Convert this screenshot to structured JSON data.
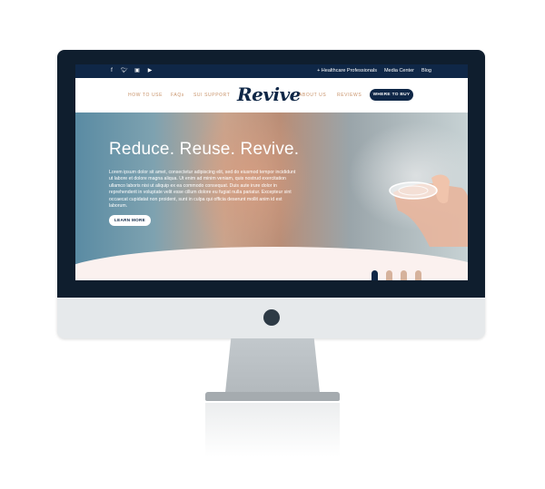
{
  "topbar": {
    "social": [
      "facebook-icon",
      "twitter-icon",
      "instagram-icon",
      "youtube-icon"
    ],
    "links": {
      "healthcare": "+ Healthcare Professionals",
      "media": "Media Center",
      "blog": "Blog"
    }
  },
  "nav": {
    "how_to_use": "HOW TO USE",
    "faqs": "FAQs",
    "sui_support": "SUI SUPPORT",
    "logo": "Revive",
    "about": "ABOUT US",
    "reviews": "REVIEWS",
    "buy": "WHERE TO BUY"
  },
  "hero": {
    "headline": "Reduce. Reuse. Revive.",
    "body": "Lorem ipsum dolor sit amet, consectetur adipiscing elit, sed do eiusmod tempor incididunt ut labore et dolore magna aliqua. Ut enim ad minim veniam, quis nostrud exercitation ullamco laboris nisi ut aliquip ex ea commodo consequat. Duis aute irure dolor in reprehenderit in voluptate velit esse cillum dolore eu fugiat nulla pariatur. Excepteur sint occaecat cupidatat non proident, sunt in culpa qui officia deserunt mollit anim id est laborum.",
    "cta": "LEARN MORE"
  },
  "colors": {
    "navy": "#0f2747",
    "accent": "#c8936a",
    "dot_inactive": "#d6b29c"
  }
}
